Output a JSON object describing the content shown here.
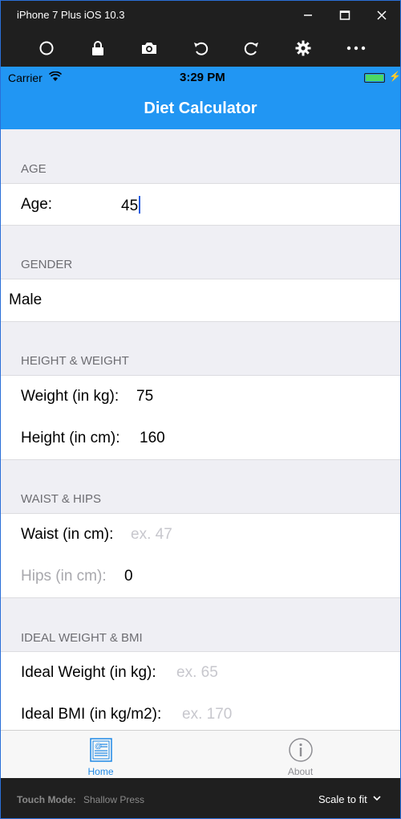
{
  "window": {
    "title": "iPhone 7 Plus iOS 10.3"
  },
  "toolbar": {
    "icons": [
      "home-icon",
      "lock-icon",
      "camera-icon",
      "rotate-left-icon",
      "rotate-right-icon",
      "settings-icon",
      "more-icon"
    ]
  },
  "status": {
    "carrier": "Carrier",
    "time": "3:29 PM",
    "battery_level": 1.0
  },
  "nav": {
    "title": "Diet Calculator"
  },
  "sections": {
    "age": {
      "header": "AGE",
      "label": "Age:",
      "value": "45"
    },
    "gender": {
      "header": "GENDER",
      "value": "Male"
    },
    "height_weight": {
      "header": "HEIGHT & WEIGHT",
      "weight_label": "Weight (in kg):",
      "weight_value": "75",
      "height_label": "Height (in cm):",
      "height_value": "160"
    },
    "waist_hips": {
      "header": "WAIST & HIPS",
      "waist_label": "Waist (in cm):",
      "waist_placeholder": "ex. 47",
      "hips_label": "Hips (in cm):",
      "hips_value": "0"
    },
    "ideal": {
      "header": "IDEAL WEIGHT & BMI",
      "weight_label": "Ideal Weight (in kg):",
      "weight_placeholder": "ex. 65",
      "bmi_label": "Ideal BMI (in kg/m2):",
      "bmi_placeholder": "ex. 170"
    }
  },
  "tabs": [
    {
      "label": "Home",
      "active": true
    },
    {
      "label": "About",
      "active": false
    }
  ],
  "footer": {
    "touch_mode_label": "Touch Mode:",
    "touch_mode_value": "Shallow Press",
    "scale_label": "Scale to fit"
  },
  "colors": {
    "accent": "#2196f3",
    "tab_active": "#1e88e5",
    "tab_inactive": "#8e8e93"
  }
}
